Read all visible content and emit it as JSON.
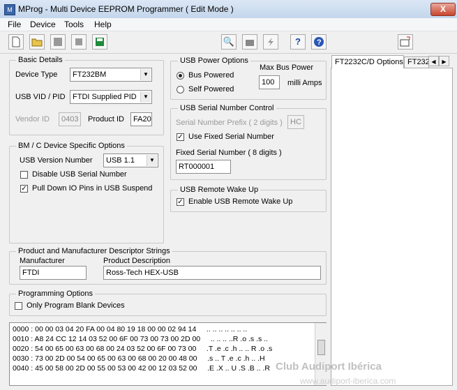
{
  "window": {
    "title": "MProg - Multi Device EEPROM Programmer ( Edit Mode )",
    "close_glyph": "X"
  },
  "menu": [
    "File",
    "Device",
    "Tools",
    "Help"
  ],
  "toolbar_icons": [
    "new-icon",
    "open-icon",
    "edit-icon",
    "stop-icon",
    "save-icon",
    "search-icon",
    "program-icon",
    "flash-icon",
    "help-icon",
    "about-icon",
    "exit-icon"
  ],
  "toolbar_glyphs": {
    "search": "🔍",
    "help": "?",
    "about": "?"
  },
  "basic": {
    "legend": "Basic Details",
    "device_type_label": "Device Type",
    "device_type_value": "FT232BM",
    "vidpid_label": "USB VID / PID",
    "vidpid_value": "FTDI Supplied PID",
    "vendor_id_label": "Vendor ID",
    "vendor_id_value": "0403",
    "product_id_label": "Product ID",
    "product_id_value": "FA20"
  },
  "bmc": {
    "legend": "BM / C Device Specific Options",
    "usb_version_label": "USB Version Number",
    "usb_version_value": "USB 1.1",
    "disable_serial_label": "Disable USB Serial Number",
    "disable_serial_checked": false,
    "pulldown_label": "Pull Down IO Pins in USB Suspend",
    "pulldown_checked": true
  },
  "power": {
    "legend": "USB Power Options",
    "bus_powered_label": "Bus Powered",
    "self_powered_label": "Self Powered",
    "selected": "bus",
    "max_power_label": "Max Bus Power",
    "max_power_value": "100",
    "units": "milli Amps"
  },
  "serial": {
    "legend": "USB Serial Number Control",
    "prefix_label": "Serial Number Prefix ( 2 digits )",
    "prefix_value": "HC",
    "use_fixed_label": "Use Fixed Serial Number",
    "use_fixed_checked": true,
    "fixed_label": "Fixed Serial Number ( 8 digits )",
    "fixed_value": "RT000001"
  },
  "wake": {
    "legend": "USB Remote Wake Up",
    "enable_label": "Enable USB Remote Wake Up",
    "enable_checked": true
  },
  "descriptors": {
    "legend": "Product and Manufacturer Descriptor Strings",
    "manufacturer_label": "Manufacturer",
    "manufacturer_value": "FTDI",
    "product_label": "Product Description",
    "product_value": "Ross-Tech HEX-USB"
  },
  "programming": {
    "legend": "Programming Options",
    "blank_only_label": "Only Program Blank Devices",
    "blank_only_checked": false
  },
  "tabs": {
    "active": "FT2232C/D Options",
    "inactive": "FT232"
  },
  "hex_dump": [
    "0000 : 00 00 03 04 20 FA 00 04 80 19 18 00 00 02 94 14     .. .. .. .. .. .. ..",
    "0010 : A8 24 CC 12 14 03 52 00 6F 00 73 00 73 00 2D 00     .. .. .. ..R .o .s .s ..",
    "0020 : 54 00 65 00 63 00 68 00 24 03 52 00 6F 00 73 00     .T .e .c .h .. .. R .o .s",
    "0030 : 73 00 2D 00 54 00 65 00 63 00 68 00 20 00 48 00     .s .. T .e .c .h .. .H",
    "0040 : 45 00 58 00 2D 00 55 00 53 00 42 00 12 03 52 00     .E .X .. U .S .B .. .R"
  ],
  "watermark": {
    "text": "Club Audiport Ibérica",
    "url": "www.audiport-iberica.com"
  }
}
